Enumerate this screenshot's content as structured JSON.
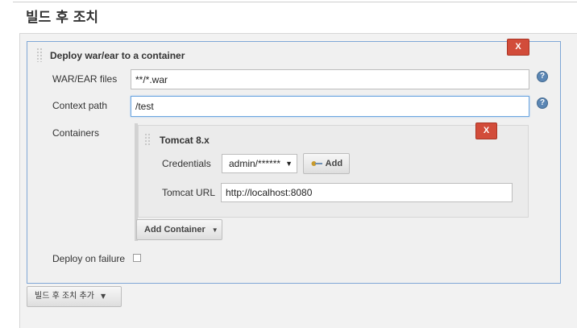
{
  "section": {
    "title": "빌드 후 조치"
  },
  "deploy_step": {
    "title": "Deploy war/ear to a container",
    "close_label": "X",
    "war_files": {
      "label": "WAR/EAR files",
      "value": "**/*.war"
    },
    "context_path": {
      "label": "Context path",
      "value": "/test"
    },
    "help_label": "?",
    "containers_label": "Containers",
    "container": {
      "title": "Tomcat 8.x",
      "close_label": "X",
      "credentials_label": "Credentials",
      "credentials_selected": "admin/******",
      "add_label": "Add",
      "url_label": "Tomcat URL",
      "url_value": "http://localhost:8080"
    },
    "add_container_label": "Add Container",
    "deploy_on_failure_label": "Deploy on failure",
    "deploy_on_failure_checked": false
  },
  "add_post_build_label": "빌드 후 조치 추가",
  "colors": {
    "close": "#d24c3a",
    "help": "#5b86b4",
    "focus_border": "#6ea6e0"
  },
  "icons": [
    "grip-icon",
    "help-icon",
    "key-icon",
    "dropdown-caret-icon"
  ]
}
